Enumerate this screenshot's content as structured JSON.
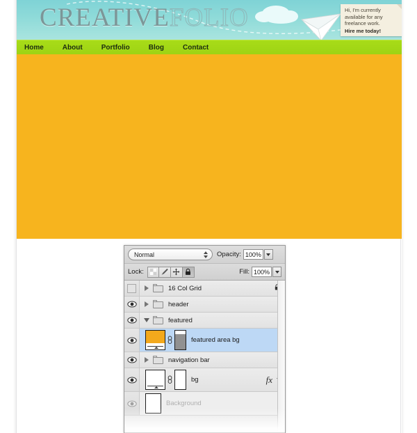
{
  "site": {
    "logo": {
      "part1": "CREATIVE",
      "part2": "FOLIO"
    },
    "sticky_note": {
      "line1": "Hi, I'm currently",
      "line2": "available for any",
      "line3": "freelance work.",
      "cta": "Hire me today!"
    },
    "nav": {
      "items": [
        {
          "label": "Home"
        },
        {
          "label": "About"
        },
        {
          "label": "Portfolio"
        },
        {
          "label": "Blog"
        },
        {
          "label": "Contact"
        }
      ]
    },
    "colors": {
      "featured_bg": "#f7b41e",
      "nav_bg": "#a8dc18",
      "header_sky": "#8fdbd9",
      "logo_creative": "#7c9698",
      "logo_folio_stroke": "#8fb6b8",
      "sticky_note_bg": "#f4efe0"
    }
  },
  "layers_panel": {
    "blend_mode": "Normal",
    "opacity": {
      "label": "Opacity:",
      "value": "100%"
    },
    "fill": {
      "label": "Fill:",
      "value": "100%"
    },
    "lock": {
      "label": "Lock:",
      "buttons": [
        {
          "icon": "lock-transparency-icon",
          "pressed": false
        },
        {
          "icon": "lock-image-brush-icon",
          "pressed": false
        },
        {
          "icon": "lock-position-move-icon",
          "pressed": false
        },
        {
          "icon": "lock-all-padlock-icon",
          "pressed": true
        }
      ]
    },
    "selection_color": "#bdd8f5",
    "rows": [
      {
        "name": "16 Col Grid",
        "type": "group",
        "visible": false,
        "expanded": false,
        "selected": false,
        "locked": true,
        "dim": false
      },
      {
        "name": "header",
        "type": "group",
        "visible": true,
        "expanded": false,
        "selected": false,
        "locked": false,
        "dim": false
      },
      {
        "name": "featured",
        "type": "group",
        "visible": true,
        "expanded": true,
        "selected": false,
        "locked": false,
        "dim": false
      },
      {
        "name": "featured area bg",
        "type": "layer",
        "visible": true,
        "selected": true,
        "has_mask": true,
        "linked": true,
        "thumb": "orange-gradient-thumbnail",
        "mask_thumb": "grey-white-mask-thumbnail",
        "dim": false
      },
      {
        "name": "navigation bar",
        "type": "group",
        "visible": true,
        "expanded": false,
        "selected": false,
        "locked": false,
        "dim": false
      },
      {
        "name": "bg",
        "type": "layer",
        "visible": true,
        "selected": false,
        "has_mask": true,
        "linked": true,
        "thumb": "white-gradient-thumbnail",
        "mask_thumb": "white-mask-thumbnail",
        "fx": "fx",
        "dim": false
      },
      {
        "name": "Background",
        "type": "layer",
        "visible": true,
        "selected": false,
        "thumb": "white-thumbnail",
        "dim": true
      }
    ]
  }
}
